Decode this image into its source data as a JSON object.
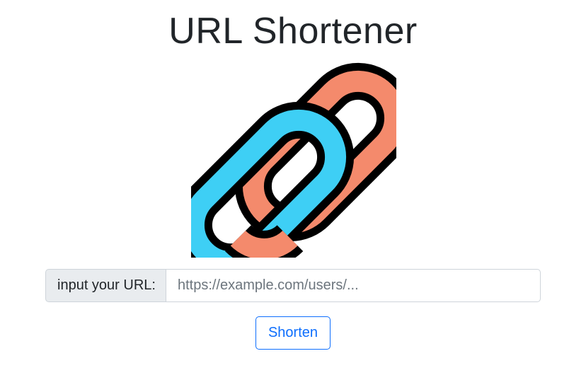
{
  "header": {
    "title": "URL Shortener"
  },
  "logo": {
    "icon": "chain-link-icon",
    "colors": {
      "front_link": "#3ecff5",
      "back_link": "#f48a6c",
      "outline": "#000000"
    }
  },
  "form": {
    "input_label": "input your URL:",
    "input_value": "",
    "input_placeholder": "https://example.com/users/...",
    "submit_label": "Shorten"
  },
  "theme": {
    "primary": "#0d6efd",
    "label_bg": "#e9ecef",
    "border": "#ced4da",
    "text": "#212529"
  }
}
